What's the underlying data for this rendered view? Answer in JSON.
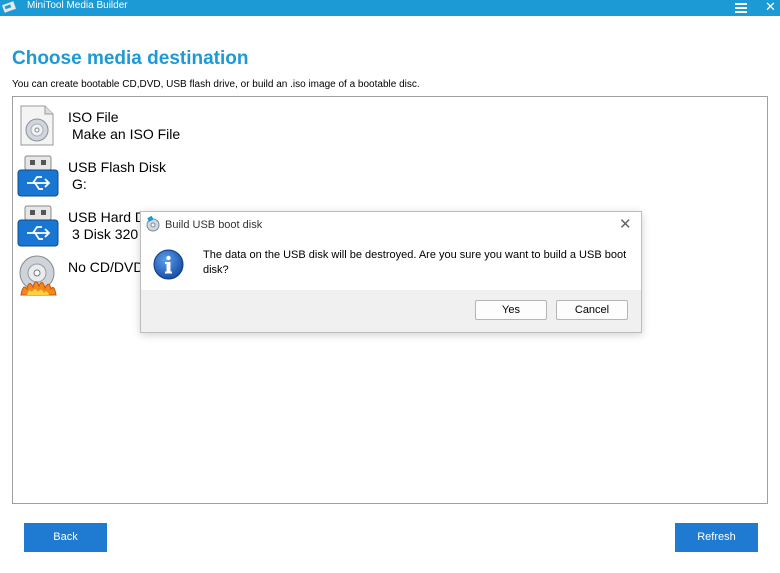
{
  "window": {
    "title": "MiniTool Media Builder",
    "accent_color": "#1c9ad6"
  },
  "header": {
    "title": "Choose media destination",
    "subtitle": "You can create bootable CD,DVD, USB flash drive, or build an .iso image of a bootable disc."
  },
  "media_options": [
    {
      "name": "ISO File",
      "detail": "Make an ISO File",
      "icon": "iso-file-icon"
    },
    {
      "name": "USB Flash Disk",
      "detail": "G:",
      "icon": "usb-flash-icon"
    },
    {
      "name": "USB Hard Disk",
      "detail": "3 Disk  320",
      "icon": "usb-hard-disk-icon"
    },
    {
      "name": "No CD/DVD",
      "detail": "",
      "icon": "cd-dvd-icon"
    }
  ],
  "buttons": {
    "back": "Back",
    "refresh": "Refresh",
    "color": "#1e7bd1"
  },
  "dialog": {
    "title": "Build USB boot disk",
    "message": "The data on the USB disk will be destroyed. Are you sure you want to build a USB boot disk?",
    "yes": "Yes",
    "cancel": "Cancel",
    "icon": "info-icon"
  }
}
